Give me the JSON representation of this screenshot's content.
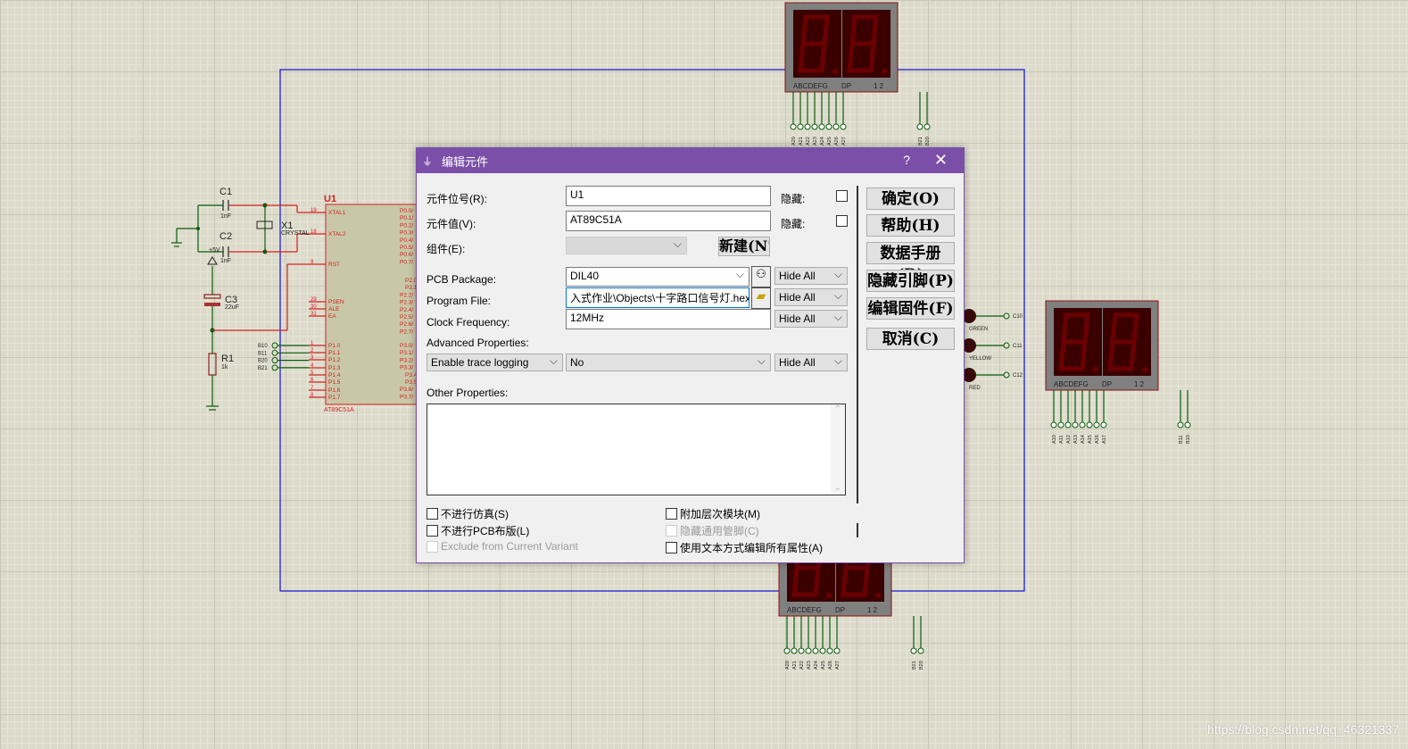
{
  "schematic": {
    "c1": "C1",
    "c1v": "1nF",
    "c2": "C2",
    "c2v": "1nF",
    "x1": "X1",
    "x1v": "CRYSTAL",
    "c3": "C3",
    "c3v": "22uF",
    "r1": "R1",
    "r1v": "1k",
    "power": "+5V",
    "u1": "U1",
    "u1v": "AT89C51A",
    "left_pins": [
      [
        "19",
        "XTAL1"
      ],
      [
        "18",
        "XTAL2"
      ],
      [
        "9",
        "RST"
      ],
      [
        "29",
        "PSEN"
      ],
      [
        "30",
        "ALE"
      ],
      [
        "31",
        "EA"
      ],
      [
        "1",
        "P1.0"
      ],
      [
        "2",
        "P1.1"
      ],
      [
        "3",
        "P1.2"
      ],
      [
        "4",
        "P1.3"
      ],
      [
        "5",
        "P1.4"
      ],
      [
        "6",
        "P1.5"
      ],
      [
        "7",
        "P1.6"
      ],
      [
        "8",
        "P1.7"
      ]
    ],
    "right_pins": [
      "P0.0/",
      "P0.1/",
      "P0.2/",
      "P0.3/",
      "P0.4/",
      "P0.5/",
      "P0.6/",
      "P0.7/",
      "P2.0",
      "P2.1",
      "P2.2/",
      "P2.3/",
      "P2.4/",
      "P2.5/",
      "P2.6/",
      "P2.7/",
      "P3.0/",
      "P3.1/",
      "P3.2/",
      "P3.3/",
      "P3.4",
      "P3.5",
      "P3.6/",
      "P3.7/"
    ],
    "p1_terminals": [
      "B10",
      "B11",
      "B20",
      "B21"
    ],
    "leds": [
      [
        "GREEN",
        "C10"
      ],
      [
        "YELLOW",
        "C11"
      ],
      [
        "RED",
        "C12"
      ]
    ],
    "seg_label": "ABCDEFG",
    "dp_label": "DP",
    "digit_label": "1 2",
    "disp_top_pins": [
      "A20",
      "A21",
      "A22",
      "A23",
      "A24",
      "A25",
      "A26",
      "A27",
      "B21",
      "B20"
    ],
    "disp_right_pins": [
      "A10",
      "A11",
      "A12",
      "A13",
      "A14",
      "A15",
      "A16",
      "A17",
      "B11",
      "B10"
    ],
    "disp_bottom_pins": [
      "A20",
      "A21",
      "A22",
      "A23",
      "A24",
      "A25",
      "A26",
      "A27",
      "B21",
      "B20"
    ]
  },
  "dialog": {
    "title": "编辑元件",
    "help": "?",
    "close": "✕",
    "ref_label": "元件位号(R):",
    "ref_value": "U1",
    "hide1": "隐藏:",
    "value_label": "元件值(V):",
    "value_value": "AT89C51A",
    "hide2": "隐藏:",
    "group_label": "组件(E):",
    "new_btn": "新建(N'",
    "pcb_label": "PCB Package:",
    "pcb_value": "DIL40",
    "pcb_vis": "Hide All",
    "prog_label": "Program File:",
    "prog_value": "入式作业\\Objects\\十字路口信号灯.hex",
    "prog_vis": "Hide All",
    "clock_label": "Clock Frequency:",
    "clock_value": "12MHz",
    "clock_vis": "Hide All",
    "adv_label": "Advanced Properties:",
    "adv_prop": "Enable trace logging",
    "adv_value": "No",
    "adv_vis": "Hide All",
    "other_label": "Other Properties:",
    "buttons": [
      "确定(O)",
      "帮助(H)",
      "数据手册(D)",
      "隐藏引脚(P)",
      "编辑固件(F)",
      "取消(C)"
    ],
    "checks": [
      {
        "label": "不进行仿真(S)",
        "checked": false,
        "disabled": false
      },
      {
        "label": "不进行PCB布版(L)",
        "checked": false,
        "disabled": false
      },
      {
        "label": "Exclude from Current Variant",
        "checked": false,
        "disabled": true
      },
      {
        "label": "附加层次模块(M)",
        "checked": false,
        "disabled": false
      },
      {
        "label": "隐藏通用管脚(C)",
        "checked": false,
        "disabled": true
      },
      {
        "label": "使用文本方式编辑所有属性(A)",
        "checked": false,
        "disabled": false
      }
    ]
  },
  "watermark": "https://blog.csdn.net/qq_46321337"
}
